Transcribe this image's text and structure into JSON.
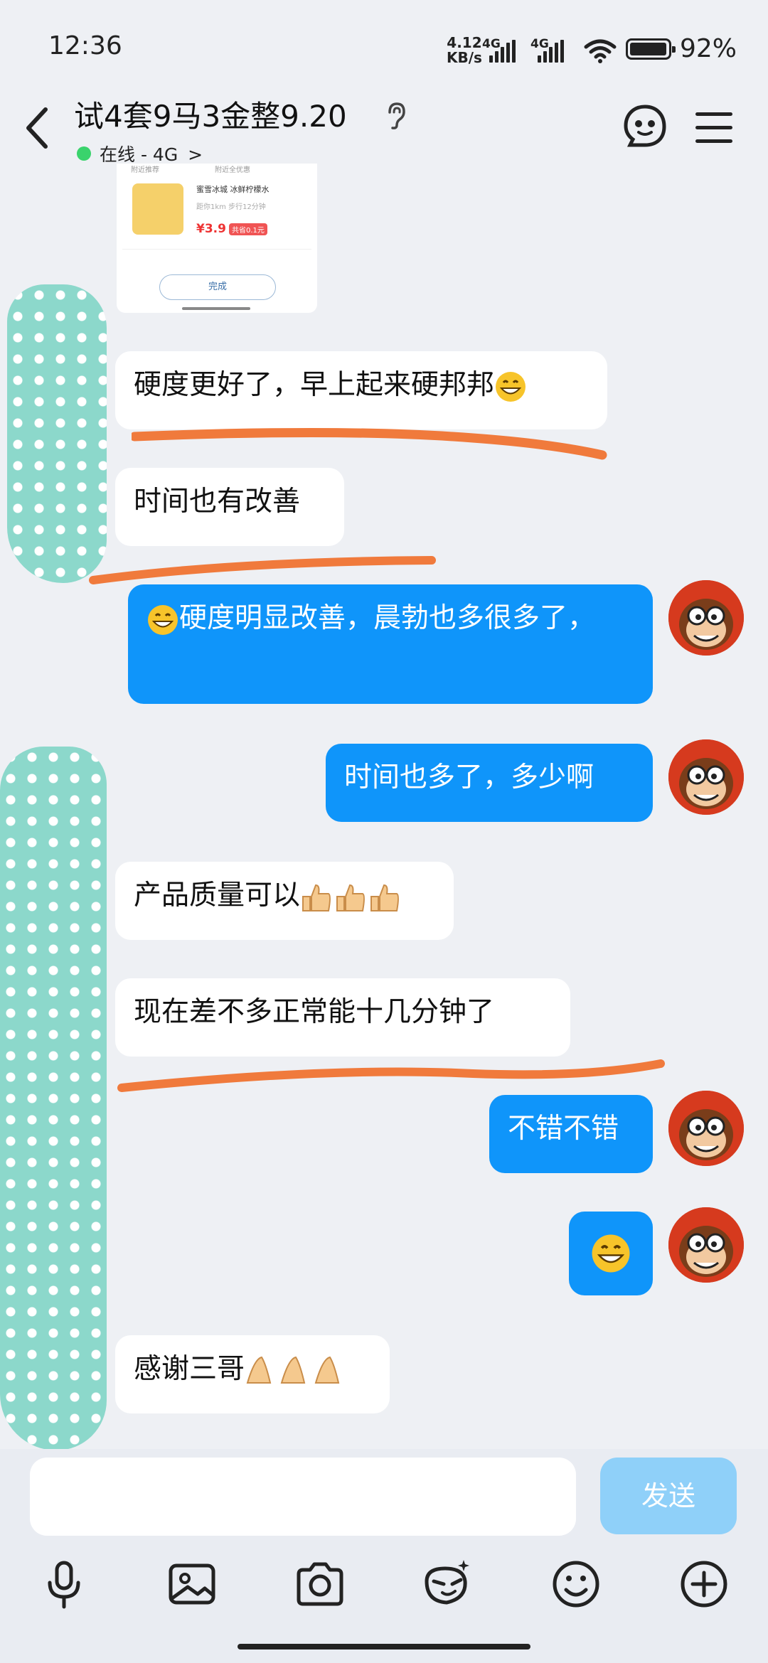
{
  "status": {
    "time": "12:36",
    "net_speed_value": "4.12",
    "net_speed_unit": "KB/s",
    "sim1": "4G",
    "sim2": "4G",
    "battery": "92%",
    "battery_level": 0.92
  },
  "header": {
    "title": "试4套9马3金整9.20",
    "status": "在线 - 4G",
    "status_chevron": ">",
    "icons": [
      "back-arrow-icon",
      "ear-icon",
      "robot-face-icon",
      "menu-icon"
    ]
  },
  "thumbnail": {
    "header_left": "附近推荐",
    "header_right": "附近全优惠",
    "shop": "蜜雪冰城  冰鲜柠檬水",
    "distance": "距你1km 步行12分钟",
    "price": "¥3.9",
    "saving": "共省0.1元",
    "button": "完成"
  },
  "messages": [
    {
      "side": "in",
      "text": "硬度更好了，早上起来硬邦邦",
      "emoji": "grin-emoji"
    },
    {
      "side": "in",
      "text": "时间也有改善"
    },
    {
      "side": "out",
      "text": "硬度明显改善，晨勃也多很多了，",
      "emoji": "grin-emoji"
    },
    {
      "side": "out",
      "text": "时间也多了，多少啊"
    },
    {
      "side": "in",
      "text": "产品质量可以",
      "emoji": "thumbs-up-emoji"
    },
    {
      "side": "in",
      "text": "现在差不多正常能十几分钟了"
    },
    {
      "side": "out",
      "text": "不错不错"
    },
    {
      "side": "out",
      "text": "",
      "emoji": "grin-emoji"
    },
    {
      "side": "in",
      "text": "感谢三哥",
      "emoji": "folded-hands-emoji"
    }
  ],
  "input": {
    "value": "",
    "send_label": "发送",
    "tools": [
      "microphone-icon",
      "image-icon",
      "camera-icon",
      "sticker-icon",
      "smiley-icon",
      "plus-icon"
    ]
  },
  "colors": {
    "outgoing_bubble": "#0f95fa",
    "incoming_bubble": "#ffffff",
    "background": "#eef0f4",
    "send_button": "#8fd0f9",
    "annotation_line": "#f07a3c",
    "dotted_strip": "#8cd8cb"
  }
}
